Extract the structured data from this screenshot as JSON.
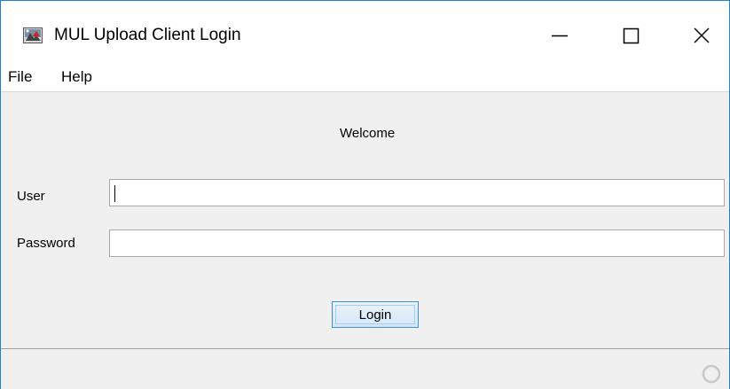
{
  "window": {
    "title": "MUL Upload Client Login",
    "icons": {
      "app": "upload-client-app-icon",
      "minimize": "minimize-icon",
      "maximize": "maximize-icon",
      "close": "close-icon"
    }
  },
  "menubar": {
    "items": [
      {
        "label": "File"
      },
      {
        "label": "Help"
      }
    ]
  },
  "form": {
    "welcome": "Welcome",
    "user_label": "User",
    "user_value": "",
    "password_label": "Password",
    "password_value": "",
    "login_label": "Login"
  },
  "statusbar": {
    "indicator_icon": "busy-ring-icon"
  },
  "colors": {
    "window_border": "#1883d7",
    "content_background": "#f0f0f0",
    "field_border": "#a8a8a8",
    "button_border": "#3d8ee0"
  }
}
